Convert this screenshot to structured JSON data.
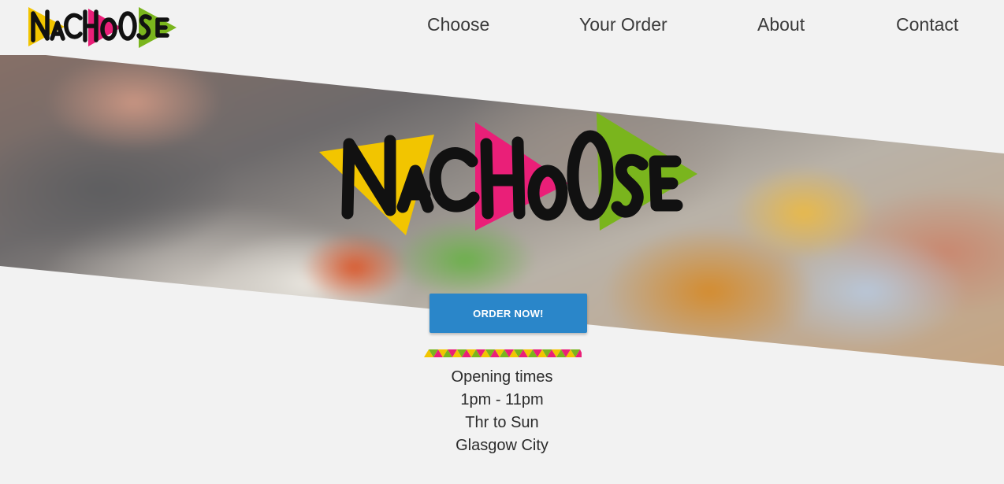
{
  "brand": {
    "name": "NaChoOse",
    "colors": {
      "yellow": "#f2c500",
      "pink": "#ea1f78",
      "green": "#7ab51d",
      "ink": "#111111",
      "button": "#2a86c9",
      "background": "#f2f2f2"
    }
  },
  "nav": {
    "items": [
      {
        "label": "Choose"
      },
      {
        "label": "Your Order"
      },
      {
        "label": "About"
      },
      {
        "label": "Contact"
      }
    ]
  },
  "hero": {
    "logo_text": "NaChoOse",
    "cta_label": "ORDER NOW!"
  },
  "info": {
    "heading": "Opening times",
    "hours": "1pm - 11pm",
    "days": "Thr to Sun",
    "location": "Glasgow City"
  },
  "icons": [
    "nachoose-logo",
    "triangle-divider"
  ]
}
